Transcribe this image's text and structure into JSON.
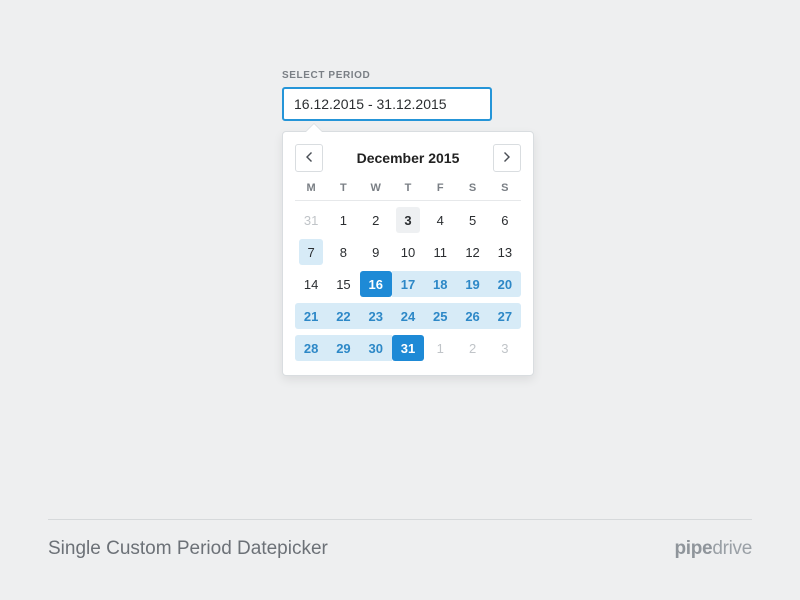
{
  "field": {
    "label": "SELECT PERIOD",
    "value": "16.12.2015 - 31.12.2015"
  },
  "calendar": {
    "month_title": "December 2015",
    "weekdays": [
      "M",
      "T",
      "W",
      "T",
      "F",
      "S",
      "S"
    ],
    "weeks": [
      [
        {
          "n": 31,
          "other": true
        },
        {
          "n": 1
        },
        {
          "n": 2
        },
        {
          "n": 3,
          "today": true
        },
        {
          "n": 4
        },
        {
          "n": 5
        },
        {
          "n": 6
        }
      ],
      [
        {
          "n": 7,
          "single_highlight": true
        },
        {
          "n": 8
        },
        {
          "n": 9
        },
        {
          "n": 10
        },
        {
          "n": 11
        },
        {
          "n": 12
        },
        {
          "n": 13
        }
      ],
      [
        {
          "n": 14
        },
        {
          "n": 15
        },
        {
          "n": 16,
          "endpoint": true
        },
        {
          "n": 17,
          "in_range": true
        },
        {
          "n": 18,
          "in_range": true
        },
        {
          "n": 19,
          "in_range": true
        },
        {
          "n": 20,
          "in_range": true,
          "row_end": true
        }
      ],
      [
        {
          "n": 21,
          "in_range": true,
          "row_start": true
        },
        {
          "n": 22,
          "in_range": true
        },
        {
          "n": 23,
          "in_range": true
        },
        {
          "n": 24,
          "in_range": true
        },
        {
          "n": 25,
          "in_range": true
        },
        {
          "n": 26,
          "in_range": true
        },
        {
          "n": 27,
          "in_range": true,
          "row_end": true
        }
      ],
      [
        {
          "n": 28,
          "in_range": true,
          "row_start": true
        },
        {
          "n": 29,
          "in_range": true
        },
        {
          "n": 30,
          "in_range": true
        },
        {
          "n": 31,
          "endpoint": true
        },
        {
          "n": 1,
          "other": true
        },
        {
          "n": 2,
          "other": true
        },
        {
          "n": 3,
          "other": true
        }
      ]
    ]
  },
  "footer": {
    "caption": "Single Custom Period Datepicker",
    "logo_pipe": "pipe",
    "logo_drive": "drive"
  }
}
